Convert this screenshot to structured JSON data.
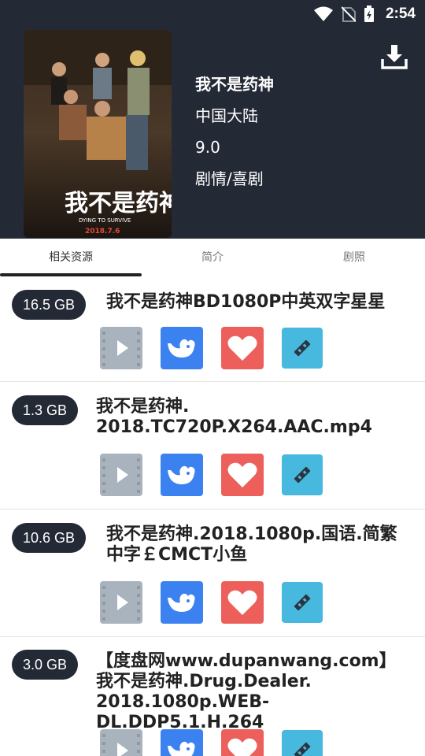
{
  "status": {
    "time": "2:54"
  },
  "movie": {
    "title": "我不是药神",
    "region": "中国大陆",
    "rating": "9.0",
    "genre": "剧情/喜剧",
    "poster_title": "我不是药神",
    "poster_subtitle": "DYING TO SURVIVE",
    "poster_date": "2018.7.6"
  },
  "tabs": [
    "相关资源",
    "简介",
    "剧照"
  ],
  "resources": [
    {
      "size": "16.5 GB",
      "title_lines": [
        "我不是药神BD1080P中英双字星星"
      ]
    },
    {
      "size": "1.3 GB",
      "title_lines": [
        "我不是药神.",
        "2018.TC720P.X264.AAC.mp4"
      ]
    },
    {
      "size": "10.6 GB",
      "title_lines": [
        "我不是药神.2018.1080p.国语.简繁",
        "中字￡CMCT小鱼"
      ]
    },
    {
      "size": "3.0 GB",
      "title_lines": [
        "【度盘网www.dupanwang.com】",
        "我不是药神.Drug.Dealer.",
        "2018.1080p.WEB-DL.DDP5.1.H.264"
      ]
    }
  ],
  "icons": {
    "play": "play-icon",
    "whale": "whale-icon",
    "favorite": "heart-icon",
    "tool": "link-tool-icon",
    "download": "download-icon"
  },
  "colors": {
    "header_bg": "#242936",
    "play_bg": "#a9b3bd",
    "whale_bg": "#3b82f0",
    "fav_bg": "#ec5f5a",
    "tool_bg": "#47b8de"
  }
}
